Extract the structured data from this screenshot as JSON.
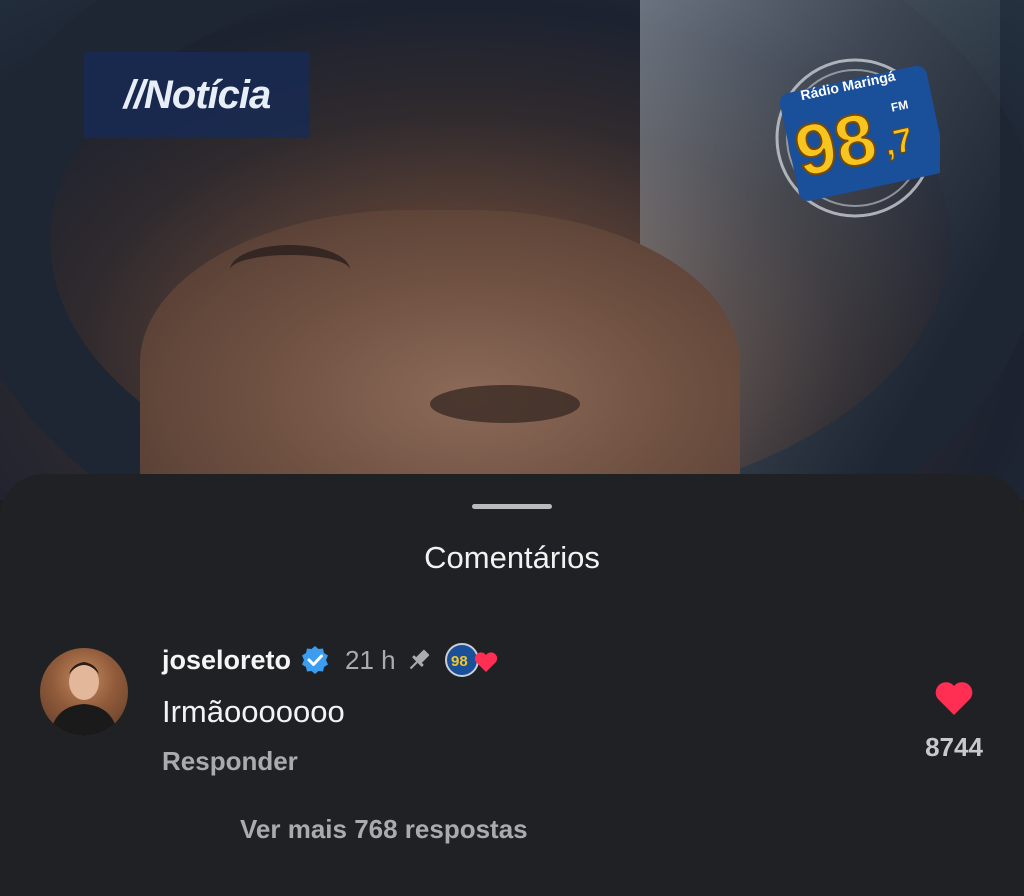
{
  "video": {
    "news_badge": "//Notícia",
    "radio_logo": {
      "name": "Rádio Maringá",
      "frequency_main": "98",
      "frequency_decimal": ",7",
      "band": "FM"
    }
  },
  "sheet": {
    "title": "Comentários"
  },
  "comment": {
    "username": "joseloreto",
    "verified_icon": "verified-badge-icon",
    "time": "21 h",
    "pinned_icon": "pin-icon",
    "liked_by_creator_icon": "creator-heart-icon",
    "text": "Irmãooooooo",
    "reply_label": "Responder",
    "like_count": "8744",
    "like_icon": "heart-icon"
  },
  "replies": {
    "view_more_label": "Ver mais 768 respostas"
  },
  "colors": {
    "verified": "#3b9cf0",
    "heart": "#ff2e52",
    "sheet_bg": "#202124"
  }
}
